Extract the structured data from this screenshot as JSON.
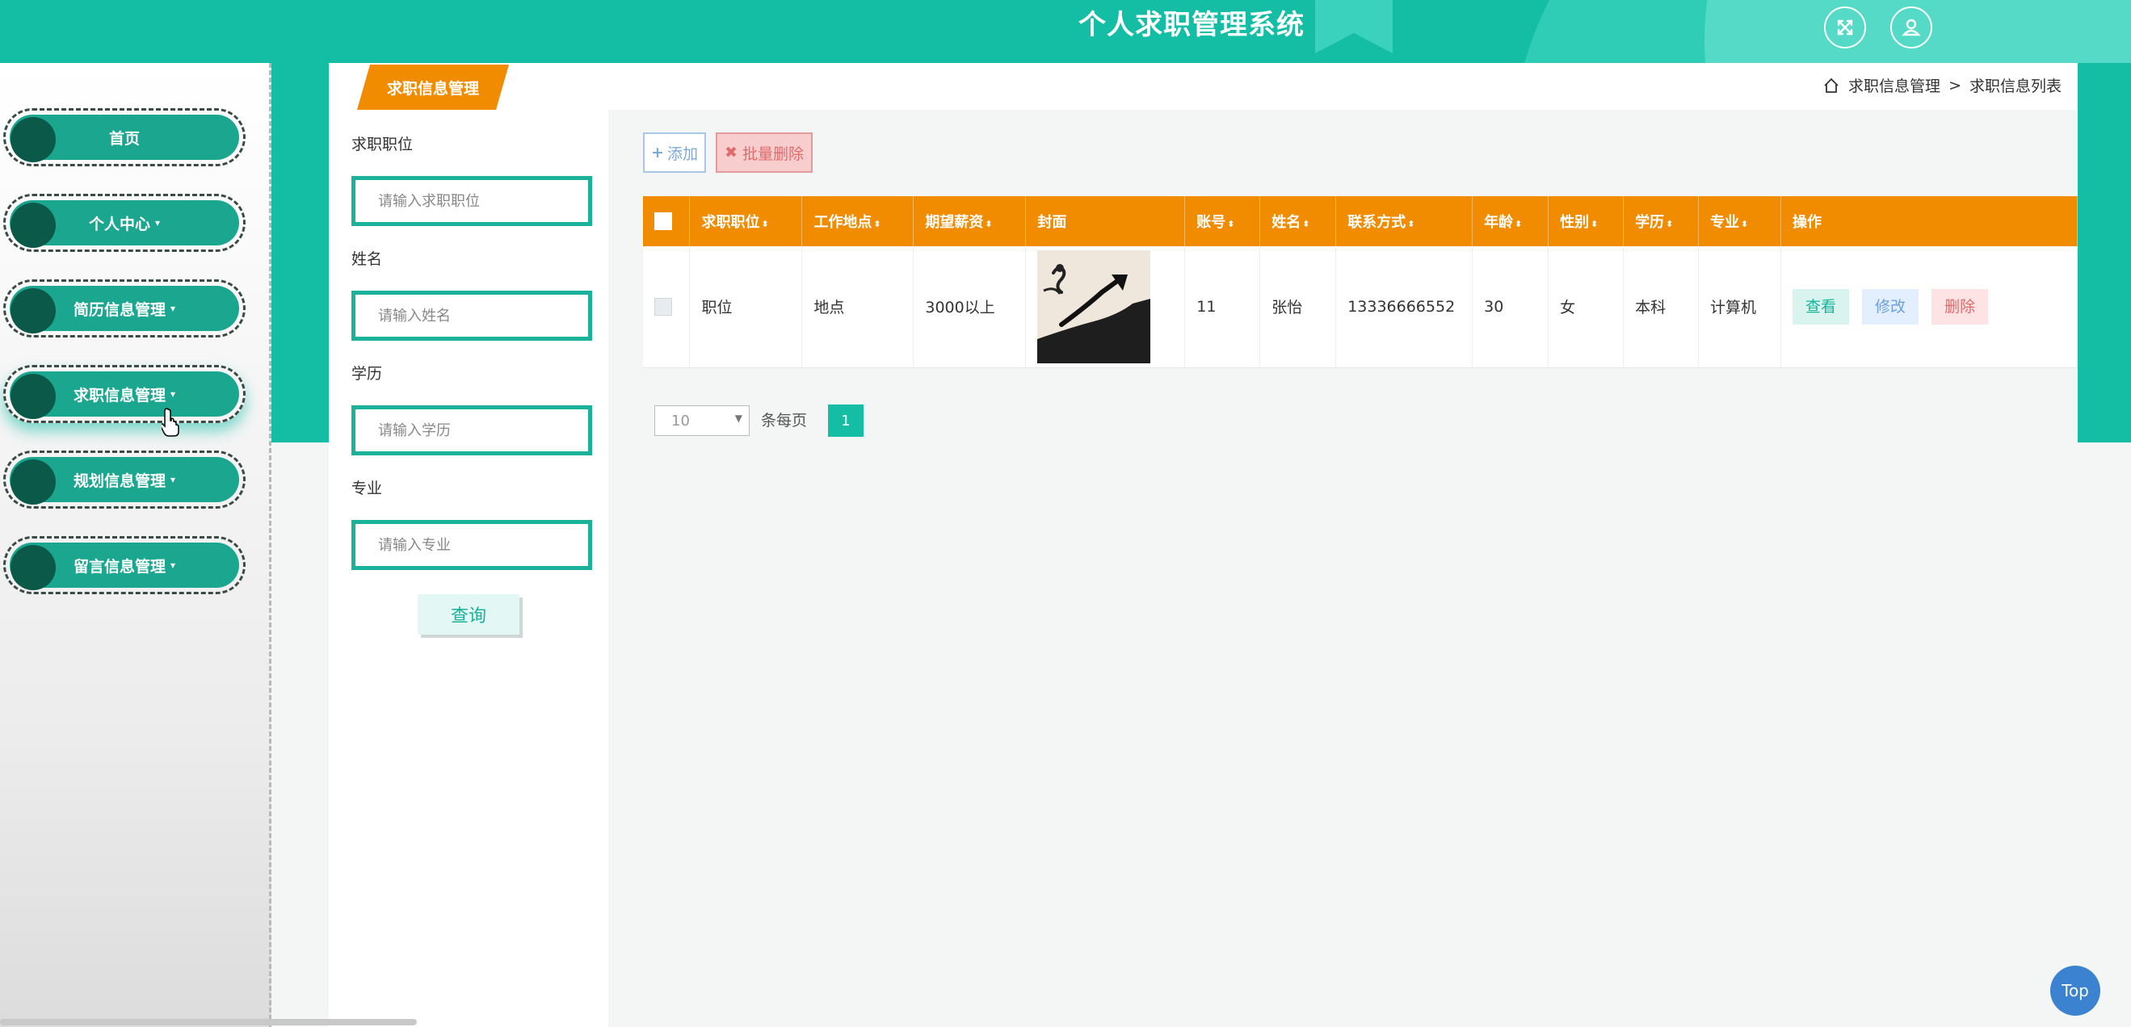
{
  "header": {
    "title": "个人求职管理系统",
    "icons": [
      "fullscreen-icon",
      "user-icon"
    ]
  },
  "sidebar": {
    "items": [
      {
        "label": "首页"
      },
      {
        "label": "个人中心",
        "caret": "▾"
      },
      {
        "label": "简历信息管理",
        "caret": "▾"
      },
      {
        "label": "求职信息管理",
        "caret": "▾"
      },
      {
        "label": "规划信息管理",
        "caret": "▾"
      },
      {
        "label": "留言信息管理",
        "caret": "▾"
      }
    ]
  },
  "page": {
    "tab": "求职信息管理",
    "breadcrumb": {
      "root": "求职信息管理",
      "separator": ">",
      "current": "求职信息列表"
    }
  },
  "search": {
    "fields": [
      {
        "label": "求职职位",
        "placeholder": "请输入求职职位"
      },
      {
        "label": "姓名",
        "placeholder": "请输入姓名"
      },
      {
        "label": "学历",
        "placeholder": "请输入学历"
      },
      {
        "label": "专业",
        "placeholder": "请输入专业"
      }
    ],
    "button": "查询"
  },
  "toolbar": {
    "add": "添加",
    "batch_delete": "批量删除"
  },
  "table": {
    "headers": [
      "求职职位",
      "工作地点",
      "期望薪资",
      "封面",
      "账号",
      "姓名",
      "联系方式",
      "年龄",
      "性别",
      "学历",
      "专业",
      "操作"
    ],
    "sort_glyph": "⬍",
    "rows": [
      {
        "position": "职位",
        "location": "地点",
        "salary": "3000以上",
        "account": "11",
        "name": "张怡",
        "phone": "13336666552",
        "age": "30",
        "gender": "女",
        "education": "本科",
        "major": "计算机",
        "actions": {
          "view": "查看",
          "edit": "修改",
          "delete": "删除"
        }
      }
    ]
  },
  "pagination": {
    "page_size": "10",
    "per_page_label": "条每页",
    "current_page": "1"
  },
  "top_button": "Top",
  "colors": {
    "teal": "#14bea5",
    "orange": "#f18b00",
    "dark_teal": "#0b5a49"
  }
}
